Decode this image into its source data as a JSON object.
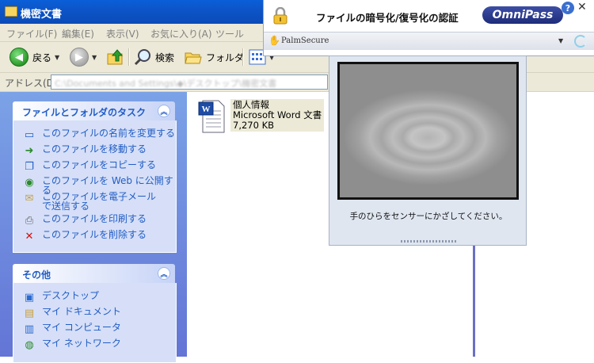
{
  "window": {
    "title": "機密文書"
  },
  "menu": [
    "ファイル(F)",
    "編集(E)",
    "表示(V)",
    "お気に入り(A)",
    "ツール"
  ],
  "toolbar": {
    "back_label": "戻る",
    "search_label": "検索",
    "folders_label": "フォルダ"
  },
  "address": {
    "label": "アドレス(D)",
    "value": "C:\\Documents and Settings\\◆\\デスクトップ\\機密文書"
  },
  "tasks_panel": {
    "title": "ファイルとフォルダのタスク",
    "items": [
      {
        "label": "このファイルの名前を変更する",
        "icon": "rename-icon"
      },
      {
        "label": "このファイルを移動する",
        "icon": "move-icon"
      },
      {
        "label": "このファイルをコピーする",
        "icon": "copy-icon"
      },
      {
        "label": "このファイルを Web に公開する",
        "icon": "web-publish-icon"
      },
      {
        "label": "このファイルを電子メールで送信する",
        "icon": "email-icon"
      },
      {
        "label": "このファイルを印刷する",
        "icon": "print-icon"
      },
      {
        "label": "このファイルを削除する",
        "icon": "delete-icon"
      }
    ]
  },
  "other_panel": {
    "title": "その他",
    "items": [
      {
        "label": "デスクトップ",
        "icon": "desktop-icon"
      },
      {
        "label": "マイ ドキュメント",
        "icon": "my-documents-icon"
      },
      {
        "label": "マイ コンピュータ",
        "icon": "my-computer-icon"
      },
      {
        "label": "マイ ネットワーク",
        "icon": "my-network-icon"
      }
    ]
  },
  "file": {
    "name": "個人情報",
    "type": "Microsoft Word 文書",
    "size": "7,270 KB"
  },
  "omnipass": {
    "title": "ファイルの暗号化/復号化の認証",
    "brand": "OmniPass",
    "sensor": "PalmSecure",
    "prompt": "手のひらをセンサーにかざしてください。"
  },
  "colors": {
    "titlebar": "#0b55c8",
    "task_link": "#215dc6",
    "panel_bg": "#d6dff7",
    "omnipass_brand": "#2a3a8f"
  }
}
